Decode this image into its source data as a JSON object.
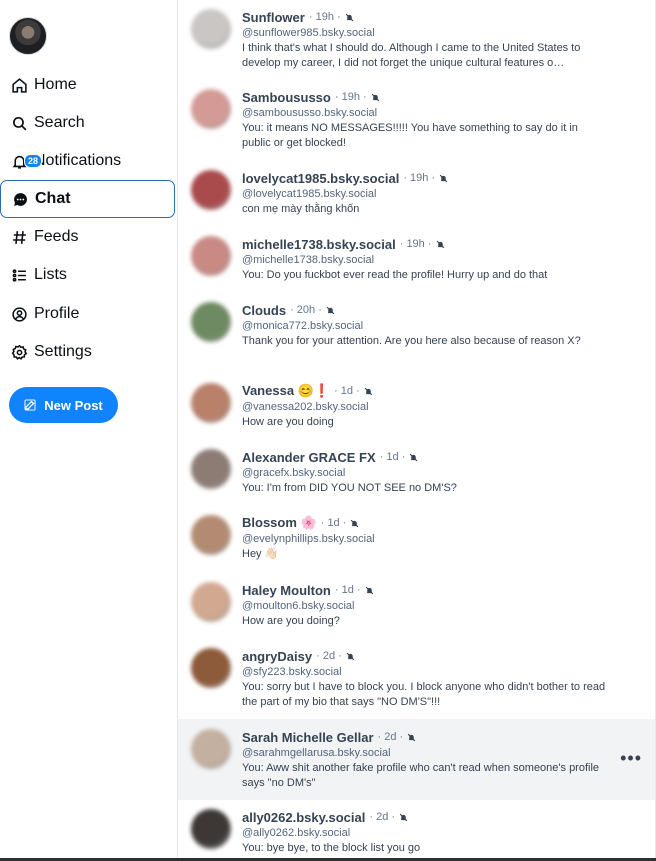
{
  "sidebar": {
    "items": [
      {
        "label": "Home",
        "icon": "home-icon"
      },
      {
        "label": "Search",
        "icon": "search-icon"
      },
      {
        "label": "Notifications",
        "icon": "bell-icon",
        "badge": "28"
      },
      {
        "label": "Chat",
        "icon": "chat-icon",
        "active": true
      },
      {
        "label": "Feeds",
        "icon": "hash-icon"
      },
      {
        "label": "Lists",
        "icon": "list-icon"
      },
      {
        "label": "Profile",
        "icon": "profile-icon"
      },
      {
        "label": "Settings",
        "icon": "gear-icon"
      }
    ],
    "new_post_label": "New Post"
  },
  "chats": [
    {
      "name": "Sunflower",
      "time": "19h",
      "handle": "@sunflower985.bsky.social",
      "preview": "I think that's what I should do. Although I came to the United States to develop my career, I did not forget the unique cultural features o…",
      "avatar_color": "#c9c6c4"
    },
    {
      "name": "Samboususso",
      "time": "19h",
      "handle": "@samboususso.bsky.social",
      "preview": "You: it means NO MESSAGES!!!!! You have something to say do it in public or get blocked!",
      "avatar_color": "#d49b96"
    },
    {
      "name": "lovelycat1985.bsky.social",
      "time": "19h",
      "handle": "@lovelycat1985.bsky.social",
      "preview": "con mẹ mày thằng khốn",
      "avatar_color": "#a94a4c"
    },
    {
      "name": "michelle1738.bsky.social",
      "time": "19h",
      "handle": "@michelle1738.bsky.social",
      "preview": "You: Do you fuckbot ever read the profile! Hurry up and do that",
      "avatar_color": "#c98a84"
    },
    {
      "name": "Clouds",
      "time": "20h",
      "handle": "@monica772.bsky.social",
      "preview": "Thank you for your attention. Are you here also because of reason X?",
      "avatar_color": "#6e8a62"
    },
    {
      "name": "Vanessa 😊❗",
      "time": "1d",
      "handle": "@vanessa202.bsky.social",
      "preview": "How are you doing",
      "avatar_color": "#b9806a"
    },
    {
      "name": "Alexander GRACE FX",
      "time": "1d",
      "handle": "@gracefx.bsky.social",
      "preview": "You: I'm from DID YOU NOT SEE no DM'S?",
      "avatar_color": "#8c7c74"
    },
    {
      "name": "Blossom 🌸",
      "time": "1d",
      "handle": "@evelynphillips.bsky.social",
      "preview": "Hey 👋🏻",
      "avatar_color": "#b38b73"
    },
    {
      "name": "Haley Moulton",
      "time": "1d",
      "handle": "@moulton6.bsky.social",
      "preview": "How are you doing?",
      "avatar_color": "#d1a890"
    },
    {
      "name": "angryDaisy",
      "time": "2d",
      "handle": "@sfy223.bsky.social",
      "preview": "You: sorry but I have to block you. I block anyone who didn't bother to read the part of my bio that says \"NO DM'S\"!!!",
      "avatar_color": "#8d5a3a"
    },
    {
      "name": "Sarah Michelle Gellar",
      "time": "2d",
      "handle": "@sarahmgellarusa.bsky.social",
      "preview": "You: Aww shit another fake profile who can't read when someone's profile says \"no DM's\"",
      "avatar_color": "#c4b0a0"
    },
    {
      "name": "ally0262.bsky.social",
      "time": "2d",
      "handle": "@ally0262.bsky.social",
      "preview": "You: bye bye, to the block list you go",
      "avatar_color": "#3d3836"
    }
  ],
  "row_menu_label": "•••"
}
